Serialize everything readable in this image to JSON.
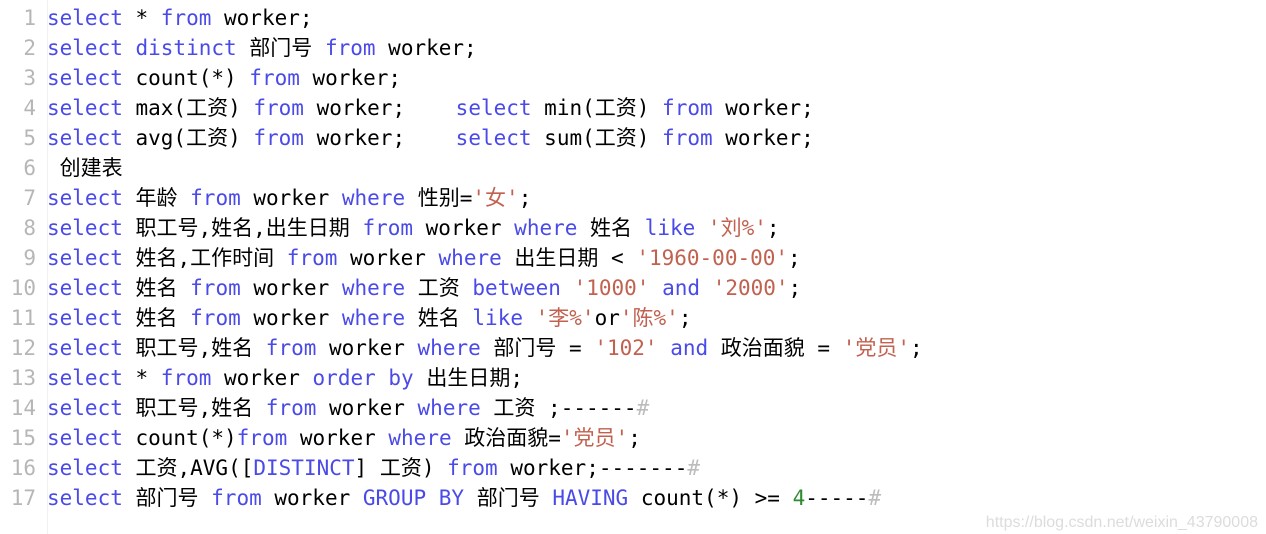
{
  "editor": {
    "background_color": "#ffffff",
    "gutter_color": "#b6b6b6",
    "keyword_color": "#4a4ae8",
    "string_color": "#c1614f",
    "number_color": "#2e8b30",
    "text_color": "#000000",
    "comment_hash_color": "#bcbcbc",
    "line_count": 17
  },
  "watermark": {
    "text": "https://blog.csdn.net/weixin_43790008"
  },
  "lines": [
    {
      "number": "1",
      "text": "select * from worker;",
      "tokens": [
        {
          "t": "select",
          "c": "kw"
        },
        {
          "t": " * ",
          "c": "plain"
        },
        {
          "t": "from",
          "c": "kw"
        },
        {
          "t": " worker;",
          "c": "plain"
        }
      ]
    },
    {
      "number": "2",
      "text": "select distinct 部门号 from worker;",
      "tokens": [
        {
          "t": "select distinct",
          "c": "kw"
        },
        {
          "t": " 部门号 ",
          "c": "plain"
        },
        {
          "t": "from",
          "c": "kw"
        },
        {
          "t": " worker;",
          "c": "plain"
        }
      ]
    },
    {
      "number": "3",
      "text": "select count(*) from worker;",
      "tokens": [
        {
          "t": "select",
          "c": "kw"
        },
        {
          "t": " count(*) ",
          "c": "plain"
        },
        {
          "t": "from",
          "c": "kw"
        },
        {
          "t": " worker;",
          "c": "plain"
        }
      ]
    },
    {
      "number": "4",
      "text": "select max(工资) from worker;    select min(工资) from worker;",
      "tokens": [
        {
          "t": "select",
          "c": "kw"
        },
        {
          "t": " max(工资) ",
          "c": "plain"
        },
        {
          "t": "from",
          "c": "kw"
        },
        {
          "t": " worker;    ",
          "c": "plain"
        },
        {
          "t": "select",
          "c": "kw"
        },
        {
          "t": " min(工资) ",
          "c": "plain"
        },
        {
          "t": "from",
          "c": "kw"
        },
        {
          "t": " worker;",
          "c": "plain"
        }
      ]
    },
    {
      "number": "5",
      "text": "select avg(工资) from worker;    select sum(工资) from worker;",
      "tokens": [
        {
          "t": "select",
          "c": "kw"
        },
        {
          "t": " avg(工资) ",
          "c": "plain"
        },
        {
          "t": "from",
          "c": "kw"
        },
        {
          "t": " worker;    ",
          "c": "plain"
        },
        {
          "t": "select",
          "c": "kw"
        },
        {
          "t": " sum(工资) ",
          "c": "plain"
        },
        {
          "t": "from",
          "c": "kw"
        },
        {
          "t": " worker;",
          "c": "plain"
        }
      ]
    },
    {
      "number": "6",
      "text": " 创建表",
      "tokens": [
        {
          "t": " 创建表",
          "c": "plain"
        }
      ]
    },
    {
      "number": "7",
      "text": "select 年龄 from worker where 性别='女';",
      "tokens": [
        {
          "t": "select",
          "c": "kw"
        },
        {
          "t": " 年龄 ",
          "c": "plain"
        },
        {
          "t": "from",
          "c": "kw"
        },
        {
          "t": " worker ",
          "c": "plain"
        },
        {
          "t": "where",
          "c": "kw"
        },
        {
          "t": " 性别=",
          "c": "plain"
        },
        {
          "t": "'女'",
          "c": "str"
        },
        {
          "t": ";",
          "c": "plain"
        }
      ]
    },
    {
      "number": "8",
      "text": "select 职工号,姓名,出生日期 from worker where 姓名 like '刘%';",
      "tokens": [
        {
          "t": "select",
          "c": "kw"
        },
        {
          "t": " 职工号,姓名,出生日期 ",
          "c": "plain"
        },
        {
          "t": "from",
          "c": "kw"
        },
        {
          "t": " worker ",
          "c": "plain"
        },
        {
          "t": "where",
          "c": "kw"
        },
        {
          "t": " 姓名 ",
          "c": "plain"
        },
        {
          "t": "like",
          "c": "kw"
        },
        {
          "t": " ",
          "c": "plain"
        },
        {
          "t": "'刘%'",
          "c": "str"
        },
        {
          "t": ";",
          "c": "plain"
        }
      ]
    },
    {
      "number": "9",
      "text": "select 姓名,工作时间 from worker where 出生日期 < '1960-00-00';",
      "tokens": [
        {
          "t": "select",
          "c": "kw"
        },
        {
          "t": " 姓名,工作时间 ",
          "c": "plain"
        },
        {
          "t": "from",
          "c": "kw"
        },
        {
          "t": " worker ",
          "c": "plain"
        },
        {
          "t": "where",
          "c": "kw"
        },
        {
          "t": " 出生日期 < ",
          "c": "plain"
        },
        {
          "t": "'1960-00-00'",
          "c": "str"
        },
        {
          "t": ";",
          "c": "plain"
        }
      ]
    },
    {
      "number": "10",
      "text": "select 姓名 from worker where 工资 between '1000' and '2000';",
      "tokens": [
        {
          "t": "select",
          "c": "kw"
        },
        {
          "t": " 姓名 ",
          "c": "plain"
        },
        {
          "t": "from",
          "c": "kw"
        },
        {
          "t": " worker ",
          "c": "plain"
        },
        {
          "t": "where",
          "c": "kw"
        },
        {
          "t": " 工资 ",
          "c": "plain"
        },
        {
          "t": "between",
          "c": "kw"
        },
        {
          "t": " ",
          "c": "plain"
        },
        {
          "t": "'1000'",
          "c": "str"
        },
        {
          "t": " ",
          "c": "plain"
        },
        {
          "t": "and",
          "c": "kw"
        },
        {
          "t": " ",
          "c": "plain"
        },
        {
          "t": "'2000'",
          "c": "str"
        },
        {
          "t": ";",
          "c": "plain"
        }
      ]
    },
    {
      "number": "11",
      "text": "select 姓名 from worker where 姓名 like '李%'or'陈%';",
      "tokens": [
        {
          "t": "select",
          "c": "kw"
        },
        {
          "t": " 姓名 ",
          "c": "plain"
        },
        {
          "t": "from",
          "c": "kw"
        },
        {
          "t": " worker ",
          "c": "plain"
        },
        {
          "t": "where",
          "c": "kw"
        },
        {
          "t": " 姓名 ",
          "c": "plain"
        },
        {
          "t": "like",
          "c": "kw"
        },
        {
          "t": " ",
          "c": "plain"
        },
        {
          "t": "'李%'",
          "c": "str"
        },
        {
          "t": "or",
          "c": "plain"
        },
        {
          "t": "'陈%'",
          "c": "str"
        },
        {
          "t": ";",
          "c": "plain"
        }
      ]
    },
    {
      "number": "12",
      "text": "select 职工号,姓名 from worker where 部门号 = '102' and 政治面貌 = '党员';",
      "tokens": [
        {
          "t": "select",
          "c": "kw"
        },
        {
          "t": " 职工号,姓名 ",
          "c": "plain"
        },
        {
          "t": "from",
          "c": "kw"
        },
        {
          "t": " worker ",
          "c": "plain"
        },
        {
          "t": "where",
          "c": "kw"
        },
        {
          "t": " 部门号 = ",
          "c": "plain"
        },
        {
          "t": "'102'",
          "c": "str"
        },
        {
          "t": " ",
          "c": "plain"
        },
        {
          "t": "and",
          "c": "kw"
        },
        {
          "t": " 政治面貌 = ",
          "c": "plain"
        },
        {
          "t": "'党员'",
          "c": "str"
        },
        {
          "t": ";",
          "c": "plain"
        }
      ]
    },
    {
      "number": "13",
      "text": "select * from worker order by 出生日期;",
      "tokens": [
        {
          "t": "select",
          "c": "kw"
        },
        {
          "t": " * ",
          "c": "plain"
        },
        {
          "t": "from",
          "c": "kw"
        },
        {
          "t": " worker ",
          "c": "plain"
        },
        {
          "t": "order by",
          "c": "kw"
        },
        {
          "t": " 出生日期;",
          "c": "plain"
        }
      ]
    },
    {
      "number": "14",
      "text": "select 职工号,姓名 from worker where 工资 ;------#",
      "tokens": [
        {
          "t": "select",
          "c": "kw"
        },
        {
          "t": " 职工号,姓名 ",
          "c": "plain"
        },
        {
          "t": "from",
          "c": "kw"
        },
        {
          "t": " worker ",
          "c": "plain"
        },
        {
          "t": "where",
          "c": "kw"
        },
        {
          "t": " 工资 ",
          "c": "plain"
        },
        {
          "t": ";------",
          "c": "cmt"
        },
        {
          "t": "#",
          "c": "hash"
        }
      ]
    },
    {
      "number": "15",
      "text": "select count(*)from worker where 政治面貌='党员';",
      "tokens": [
        {
          "t": "select",
          "c": "kw"
        },
        {
          "t": " count(*)",
          "c": "plain"
        },
        {
          "t": "from",
          "c": "kw"
        },
        {
          "t": " worker ",
          "c": "plain"
        },
        {
          "t": "where",
          "c": "kw"
        },
        {
          "t": " 政治面貌=",
          "c": "plain"
        },
        {
          "t": "'党员'",
          "c": "str"
        },
        {
          "t": ";",
          "c": "plain"
        }
      ]
    },
    {
      "number": "16",
      "text": "select 工资,AVG([DISTINCT] 工资) from worker;-------#",
      "tokens": [
        {
          "t": "select",
          "c": "kw"
        },
        {
          "t": " 工资,AVG([",
          "c": "plain"
        },
        {
          "t": "DISTINCT",
          "c": "kw"
        },
        {
          "t": "] 工资) ",
          "c": "plain"
        },
        {
          "t": "from",
          "c": "kw"
        },
        {
          "t": " worker;-------",
          "c": "cmt"
        },
        {
          "t": "#",
          "c": "hash"
        }
      ]
    },
    {
      "number": "17",
      "text": "select 部门号 from worker GROUP BY 部门号 HAVING count(*) >= 4-----#",
      "tokens": [
        {
          "t": "select",
          "c": "kw"
        },
        {
          "t": " 部门号 ",
          "c": "plain"
        },
        {
          "t": "from",
          "c": "kw"
        },
        {
          "t": " worker ",
          "c": "plain"
        },
        {
          "t": "GROUP BY",
          "c": "kw"
        },
        {
          "t": " 部门号 ",
          "c": "plain"
        },
        {
          "t": "HAVING",
          "c": "kw"
        },
        {
          "t": " count(*) >= ",
          "c": "plain"
        },
        {
          "t": "4",
          "c": "num"
        },
        {
          "t": "-----",
          "c": "cmt"
        },
        {
          "t": "#",
          "c": "hash"
        }
      ]
    }
  ]
}
